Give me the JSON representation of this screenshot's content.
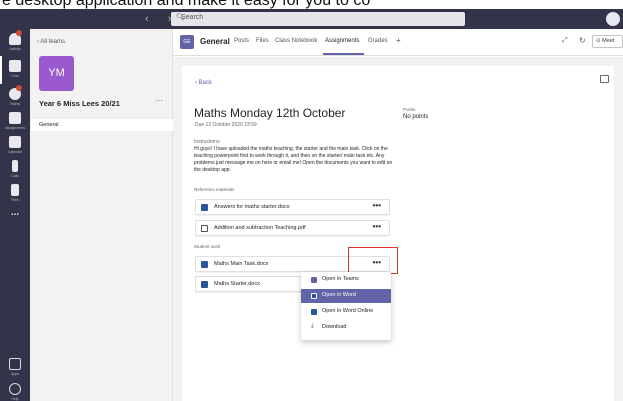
{
  "caption": "e desktop application and make it easy for you to co",
  "titlebar": {
    "nav": "‹ ›",
    "search_placeholder": "Search",
    "accent": "#33344a"
  },
  "rail": {
    "items": [
      {
        "label": "Activity",
        "icon": "bell-icon",
        "badge": true
      },
      {
        "label": "Chat",
        "icon": "chat-icon",
        "badge": false
      },
      {
        "label": "Teams",
        "icon": "teams-icon",
        "badge": true
      },
      {
        "label": "Assignments",
        "icon": "assignments-icon",
        "badge": false
      },
      {
        "label": "Calendar",
        "icon": "calendar-icon",
        "badge": false
      },
      {
        "label": "Calls",
        "icon": "phone-icon",
        "badge": false
      },
      {
        "label": "Files",
        "icon": "file-icon",
        "badge": false
      },
      {
        "label": "...",
        "icon": "more-icon",
        "badge": false
      },
      {
        "label": "Apps",
        "icon": "apps-icon",
        "badge": false
      },
      {
        "label": "Help",
        "icon": "help-icon",
        "badge": false
      }
    ]
  },
  "team_panel": {
    "back_label": "‹  All teams",
    "team_initials": "YM",
    "team_name": "Year 6 Miss Lees 20/21",
    "more": "···",
    "channel": "General"
  },
  "header": {
    "badge": "GE",
    "channel": "General",
    "tabs": [
      "Posts",
      "Files",
      "Class Notebook",
      "Assignments",
      "Grades",
      "+"
    ],
    "active_tab": "Assignments",
    "meet_label": "⊙ Meet",
    "accent": "#6264a7"
  },
  "assignment": {
    "back": "‹  Back",
    "title": "Maths Monday 12th October",
    "due": "Due 12 October 2020 23:59",
    "points_label": "Points",
    "points_value": "No points",
    "instructions_label": "Instructions",
    "instructions": "Hi guys!  I have uploaded the maths teaching, the starter and the main task. Click on the teaching powerpoint first to work through it, and then on the starter/ main task etc. Any problems just message me on here or email me! Open the documents you want to edit on the desktop app.",
    "reference_label": "Reference materials",
    "reference_files": [
      {
        "name": "Answers for maths starter.docx",
        "icon": "word-icon",
        "more": "•••"
      },
      {
        "name": "Addition and subtraction Teaching.pdf",
        "icon": "pdf-icon",
        "more": "•••"
      }
    ],
    "student_label": "Student work",
    "student_files": [
      {
        "name": "Maths Main Task.docx",
        "icon": "word-icon",
        "more": "•••"
      },
      {
        "name": "Maths Starter.docx",
        "icon": "word-icon",
        "more": ""
      }
    ]
  },
  "context_menu": {
    "items": [
      {
        "label": "Open in Teams",
        "icon": "teams-icon",
        "selected": false
      },
      {
        "label": "Open in Word",
        "icon": "word-icon",
        "selected": true
      },
      {
        "label": "Open in Word Online",
        "icon": "word-online-icon",
        "selected": false
      },
      {
        "label": "Download",
        "icon": "download-icon",
        "selected": false
      }
    ]
  },
  "colors": {
    "highlight_box": "#d9352a",
    "word_blue": "#2b579a",
    "team_avatar": "#9b59d0"
  }
}
